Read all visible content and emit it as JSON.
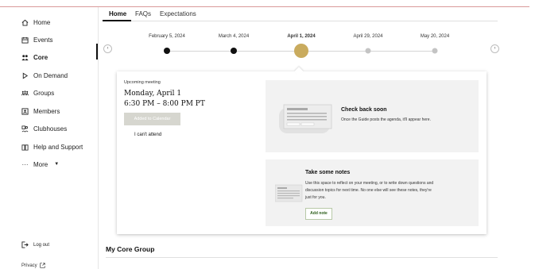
{
  "sidebar": {
    "items": [
      {
        "label": "Home",
        "icon": "home-icon"
      },
      {
        "label": "Events",
        "icon": "calendar-icon"
      },
      {
        "label": "Core",
        "icon": "people-icon",
        "active": true
      },
      {
        "label": "On Demand",
        "icon": "play-icon"
      },
      {
        "label": "Groups",
        "icon": "groups-icon"
      },
      {
        "label": "Members",
        "icon": "id-card-icon"
      },
      {
        "label": "Clubhouses",
        "icon": "clubhouse-icon"
      },
      {
        "label": "Help and Support",
        "icon": "book-icon"
      },
      {
        "label": "More",
        "icon": "more-dots-icon"
      }
    ],
    "logout_label": "Log out",
    "privacy_label": "Privacy"
  },
  "tabs": [
    "Home",
    "FAQs",
    "Expectations"
  ],
  "timeline": {
    "dates": [
      {
        "label": "February 5, 2024",
        "state": "past"
      },
      {
        "label": "March 4, 2024",
        "state": "past"
      },
      {
        "label": "April 1, 2024",
        "state": "current"
      },
      {
        "label": "April 29, 2024",
        "state": "future"
      },
      {
        "label": "May 20, 2024",
        "state": "future"
      }
    ]
  },
  "meeting": {
    "upcoming_label": "Upcoming meeting",
    "date": "Monday, April 1",
    "time": "6:30 PM – 8:00 PM PT",
    "add_calendar_label": "Added to Calendar",
    "cant_attend_label": "I can't attend"
  },
  "guide_panel": {
    "title": "Check back soon",
    "text": "Once the Guide posts the agenda, it'll appear here."
  },
  "notes_panel": {
    "title": "Take some notes",
    "text_lines": [
      "Use this space to reflect on your meeting, or to write down questions and",
      "discussion topics for next time. No one else will see these notes, they're",
      "just for you."
    ],
    "button_label": "Add note"
  },
  "section": {
    "title": "My Core Group"
  },
  "colors": {
    "accent_gold": "#c9ab5e",
    "past_dot": "#111111",
    "future_dot": "#c4c4c4",
    "note_button_text": "#2c5e1a"
  }
}
